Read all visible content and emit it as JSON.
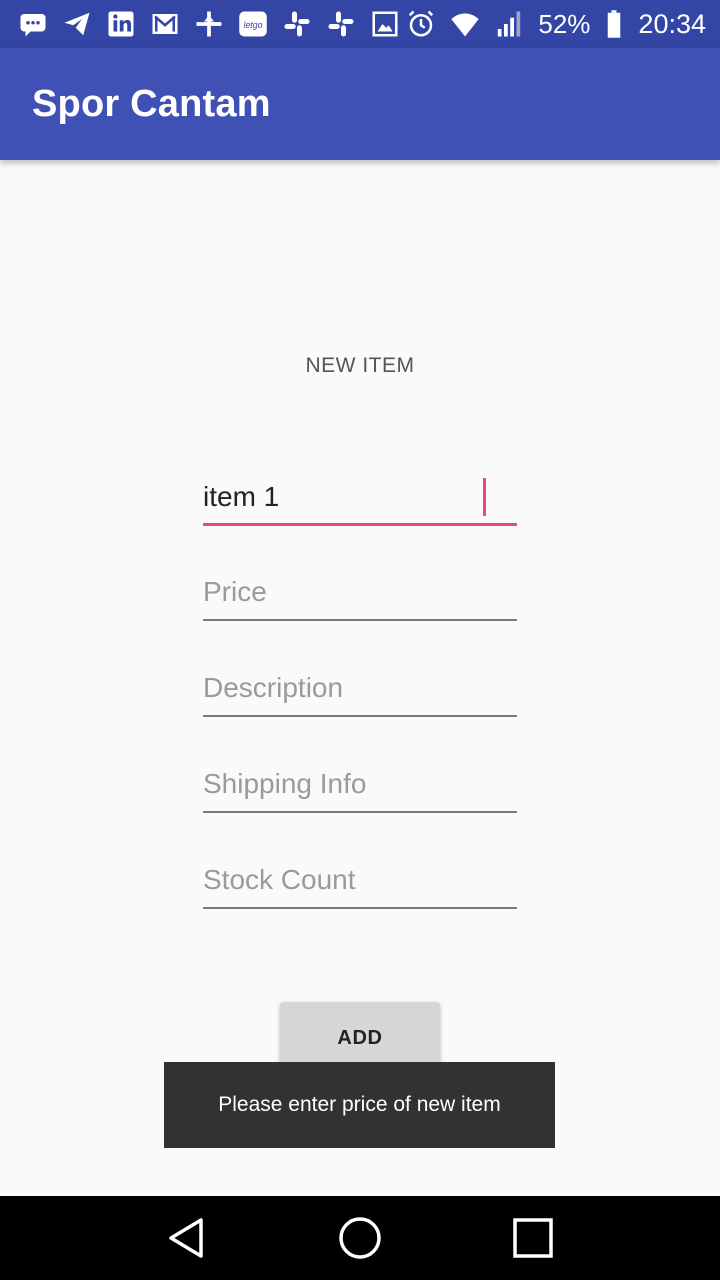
{
  "status_bar": {
    "left_icons": [
      "chat-bubble-icon",
      "telegram-icon",
      "linkedin-icon",
      "gmail-icon",
      "app-icon",
      "letgo-icon",
      "slack-icon",
      "slack-icon",
      "image-icon"
    ],
    "letgo_text": "letgo",
    "battery_percent": "52%",
    "time": "20:34"
  },
  "app_bar": {
    "title": "Spor Cantam"
  },
  "form": {
    "heading": "NEW ITEM",
    "name_value": "item 1",
    "price_placeholder": "Price",
    "description_placeholder": "Description",
    "shipping_placeholder": "Shipping Info",
    "stock_placeholder": "Stock Count",
    "add_label": "ADD"
  },
  "toast": {
    "message": "Please enter price of new item"
  },
  "colors": {
    "status_bar": "#3346a6",
    "app_bar": "#3f51b5",
    "accent": "#e8497c"
  }
}
